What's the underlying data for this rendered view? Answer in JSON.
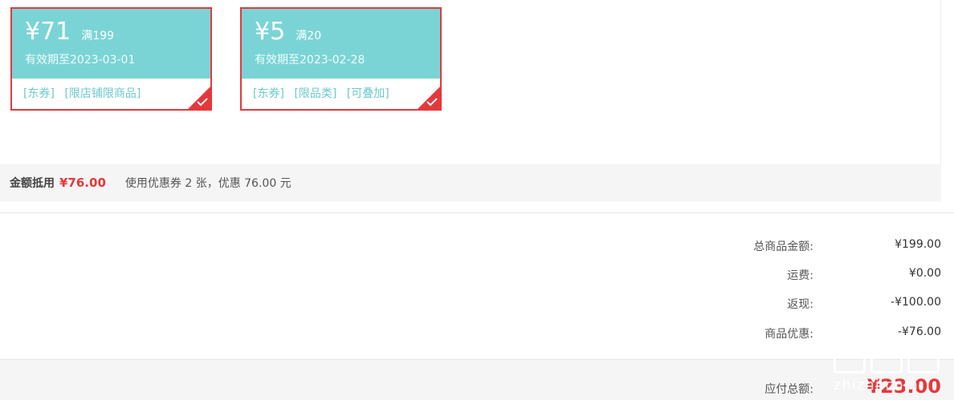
{
  "coupons": [
    {
      "amount": "¥71",
      "limit": "满199",
      "valid": "有效期至2023-03-01",
      "tags": [
        "[东券]",
        "[限店铺限商品]"
      ]
    },
    {
      "amount": "¥5",
      "limit": "满20",
      "valid": "有效期至2023-02-28",
      "tags": [
        "[东券]",
        "[限品类]",
        "[可叠加]"
      ]
    }
  ],
  "summary": {
    "label": "金额抵用",
    "value": "¥76.00",
    "note": "使用优惠券 2 张，优惠 76.00 元"
  },
  "totals": [
    {
      "label": "总商品金额:",
      "value": "¥199.00"
    },
    {
      "label": "运费:",
      "value": "¥0.00"
    },
    {
      "label": "返现:",
      "value": "-¥100.00"
    },
    {
      "label": "商品优惠:",
      "value": "-¥76.00"
    }
  ],
  "payable": {
    "label": "应付总额:",
    "value": "¥23.00"
  },
  "watermark": {
    "text": "zhizhi.com"
  },
  "colors": {
    "coupon_bg": "#7ad4d6",
    "accent_red": "#e4393c",
    "tag_text": "#6cc9cb"
  }
}
